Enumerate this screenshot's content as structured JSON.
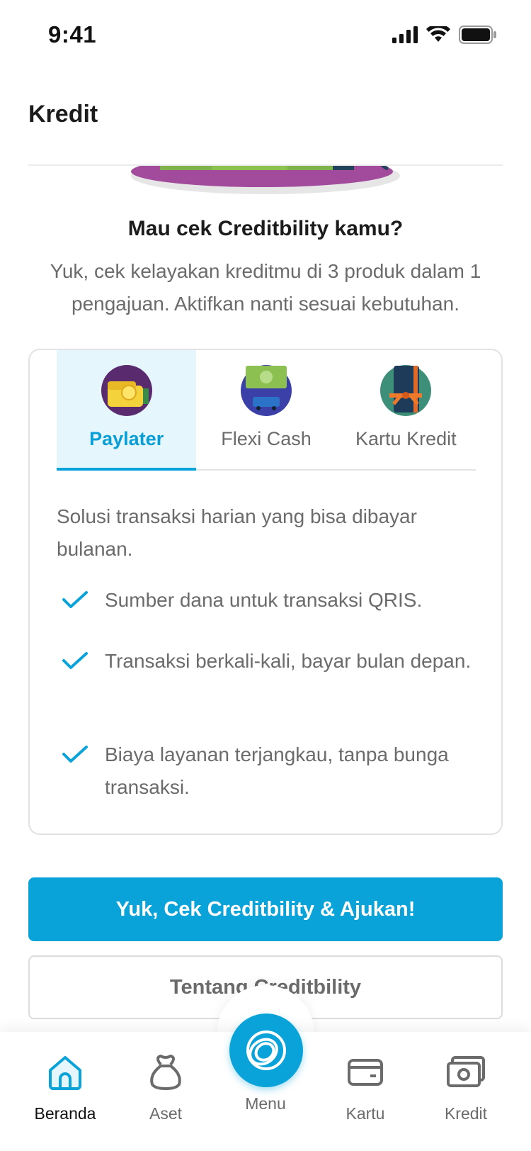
{
  "status_bar": {
    "time": "9:41"
  },
  "header": {
    "title": "Kredit"
  },
  "intro": {
    "headline": "Mau cek Creditbility kamu?",
    "subline": "Yuk, cek kelayakan kreditmu di 3 produk dalam 1 pengajuan. Aktifkan nanti sesuai kebutuhan."
  },
  "tabs": [
    {
      "label": "Paylater",
      "icon": "paylater-wallet-icon",
      "active": true
    },
    {
      "label": "Flexi Cash",
      "icon": "flexi-cash-icon",
      "active": false
    },
    {
      "label": "Kartu Kredit",
      "icon": "credit-card-gift-icon",
      "active": false
    }
  ],
  "card": {
    "description": "Solusi transaksi harian yang bisa dibayar bulanan.",
    "benefits": [
      "Sumber dana untuk transaksi QRIS.",
      "Transaksi berkali-kali, bayar bulan depan.",
      "Biaya layanan terjangkau, tanpa bunga transaksi."
    ]
  },
  "buttons": {
    "primary": "Yuk, Cek Creditbility & Ajukan!",
    "secondary": "Tentang Creditbility"
  },
  "bottom_nav": {
    "items": [
      {
        "label": "Beranda",
        "icon": "home-icon",
        "active": true
      },
      {
        "label": "Aset",
        "icon": "money-bag-icon",
        "active": false
      },
      {
        "label": "Menu",
        "icon": "menu-rings-icon",
        "active": false
      },
      {
        "label": "Kartu",
        "icon": "card-icon",
        "active": false
      },
      {
        "label": "Kredit",
        "icon": "credit-cash-icon",
        "active": false
      }
    ]
  },
  "colors": {
    "accent": "#0aa3d9",
    "tab_active_bg": "#e6f6fd",
    "text_muted": "#6b6b6b"
  }
}
